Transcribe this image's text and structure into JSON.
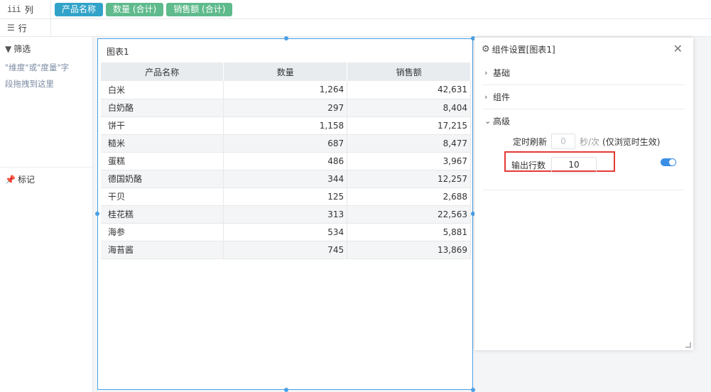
{
  "shelf": {
    "columns_label": "列",
    "rows_label": "行",
    "column_pills": [
      {
        "label": "产品名称",
        "kind": "dimension"
      },
      {
        "label": "数量 (合计)",
        "kind": "measure"
      },
      {
        "label": "销售额 (合计)",
        "kind": "measure"
      }
    ]
  },
  "left_panel": {
    "filter_title": "筛选",
    "filter_hint_line1": "\"维度\"或\"度量\"字",
    "filter_hint_line2": "段拖拽到这里",
    "marks_title": "标记"
  },
  "widget": {
    "title": "图表1",
    "columns": [
      "产品名称",
      "数量",
      "销售额"
    ],
    "rows": [
      [
        "白米",
        "1,264",
        "42,631"
      ],
      [
        "白奶酪",
        "297",
        "8,404"
      ],
      [
        "饼干",
        "1,158",
        "17,215"
      ],
      [
        "糙米",
        "687",
        "8,477"
      ],
      [
        "蛋糕",
        "486",
        "3,967"
      ],
      [
        "德国奶酪",
        "344",
        "12,257"
      ],
      [
        "干贝",
        "125",
        "2,688"
      ],
      [
        "桂花糕",
        "313",
        "22,563"
      ],
      [
        "海参",
        "534",
        "5,881"
      ],
      [
        "海苔酱",
        "745",
        "13,869"
      ]
    ]
  },
  "settings": {
    "title": "组件设置[图表1]",
    "sections": {
      "basic": "基础",
      "component": "组件",
      "advanced": "高级"
    },
    "refresh_label": "定时刷新",
    "refresh_value": "0",
    "refresh_unit": "秒/次",
    "refresh_note": "(仅浏览时生效)",
    "output_rows_label": "输出行数",
    "output_rows_value": "10",
    "toggle_on": true
  },
  "colors": {
    "dimension_pill": "#31a3c9",
    "measure_pill": "#5fba8c",
    "selection_border": "#4aa0e6",
    "highlight_box": "#e53935",
    "toggle": "#3a8ee6"
  }
}
